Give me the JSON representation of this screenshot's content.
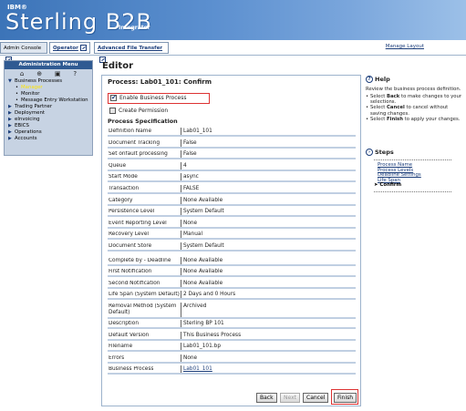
{
  "banner": {
    "ibm": "IBM®",
    "product": "Sterling B2B",
    "suffix": "Integrator"
  },
  "tabs": {
    "admin_console": "Admin Console",
    "operator": "Operator",
    "advanced_file_transfer": "Advanced File Transfer",
    "manage_layout": "Manage Layout"
  },
  "menu": {
    "title": "Administration Menu",
    "items": [
      {
        "label": "Business Processes",
        "level": 0,
        "expanded": true
      },
      {
        "label": "Manager",
        "level": 1,
        "selected": true
      },
      {
        "label": "Monitor",
        "level": 1
      },
      {
        "label": "Message Entry Workstation",
        "level": 1
      },
      {
        "label": "Trading Partner",
        "level": 0
      },
      {
        "label": "Deployment",
        "level": 0
      },
      {
        "label": "eInvoicing",
        "level": 0
      },
      {
        "label": "EBICS",
        "level": 0
      },
      {
        "label": "Operations",
        "level": 0
      },
      {
        "label": "Accounts",
        "level": 0
      }
    ]
  },
  "editor": {
    "heading": "Editor",
    "process_title": "Process: Lab01_101: Confirm",
    "enable_bp_label": "Enable Business Process",
    "enable_bp_checked": true,
    "create_permission_label": "Create Permission",
    "spec_heading": "Process Specification",
    "spec_rows": [
      {
        "label": "Definition Name",
        "value": "Lab01_101"
      },
      {
        "label": "Document Tracking",
        "value": "False"
      },
      {
        "label": "Set onfault processing",
        "value": "False"
      },
      {
        "label": "Queue",
        "value": "4"
      },
      {
        "label": "Start Mode",
        "value": "async"
      },
      {
        "label": "Transaction",
        "value": "FALSE"
      },
      {
        "label": "Category",
        "value": "None Available"
      },
      {
        "label": "Persistence Level",
        "value": "System Default"
      },
      {
        "label": "Event Reporting Level",
        "value": "None"
      },
      {
        "label": "Recovery Level",
        "value": "Manual"
      },
      {
        "label": "Document Store",
        "value": "System Default"
      },
      {
        "label": "Complete by - Deadline",
        "value": "None Available"
      },
      {
        "label": "First Notification",
        "value": "None Available"
      },
      {
        "label": "Second Notification",
        "value": "None Available"
      },
      {
        "label": "Life Span (System Default)",
        "value": "2 Days and 0 Hours"
      },
      {
        "label": "Removal Method (System Default)",
        "value": "Archived"
      },
      {
        "label": "Description",
        "value": "Sterling BP 101"
      },
      {
        "label": "Default Version",
        "value": "This Business Process"
      },
      {
        "label": "Filename",
        "value": "Lab01_101.bp"
      },
      {
        "label": "Errors",
        "value": "None"
      },
      {
        "label": "Business Process",
        "value": "Lab01_101"
      }
    ],
    "buttons": {
      "back": "Back",
      "next": "Next",
      "cancel": "Cancel",
      "finish": "Finish"
    }
  },
  "help": {
    "title": "Help",
    "intro": "Review the business process definition.",
    "bullets": [
      {
        "pre": "Select ",
        "bold": "Back",
        "post": " to make changes to your selections."
      },
      {
        "pre": "Select ",
        "bold": "Cancel",
        "post": " to cancel without saving changes."
      },
      {
        "pre": "Select ",
        "bold": "Finish",
        "post": " to apply your changes."
      }
    ]
  },
  "steps": {
    "title": "Steps",
    "items": [
      "Process Name",
      "Process Levels",
      "Deadline Settings",
      "Life Span",
      "Confirm"
    ]
  }
}
